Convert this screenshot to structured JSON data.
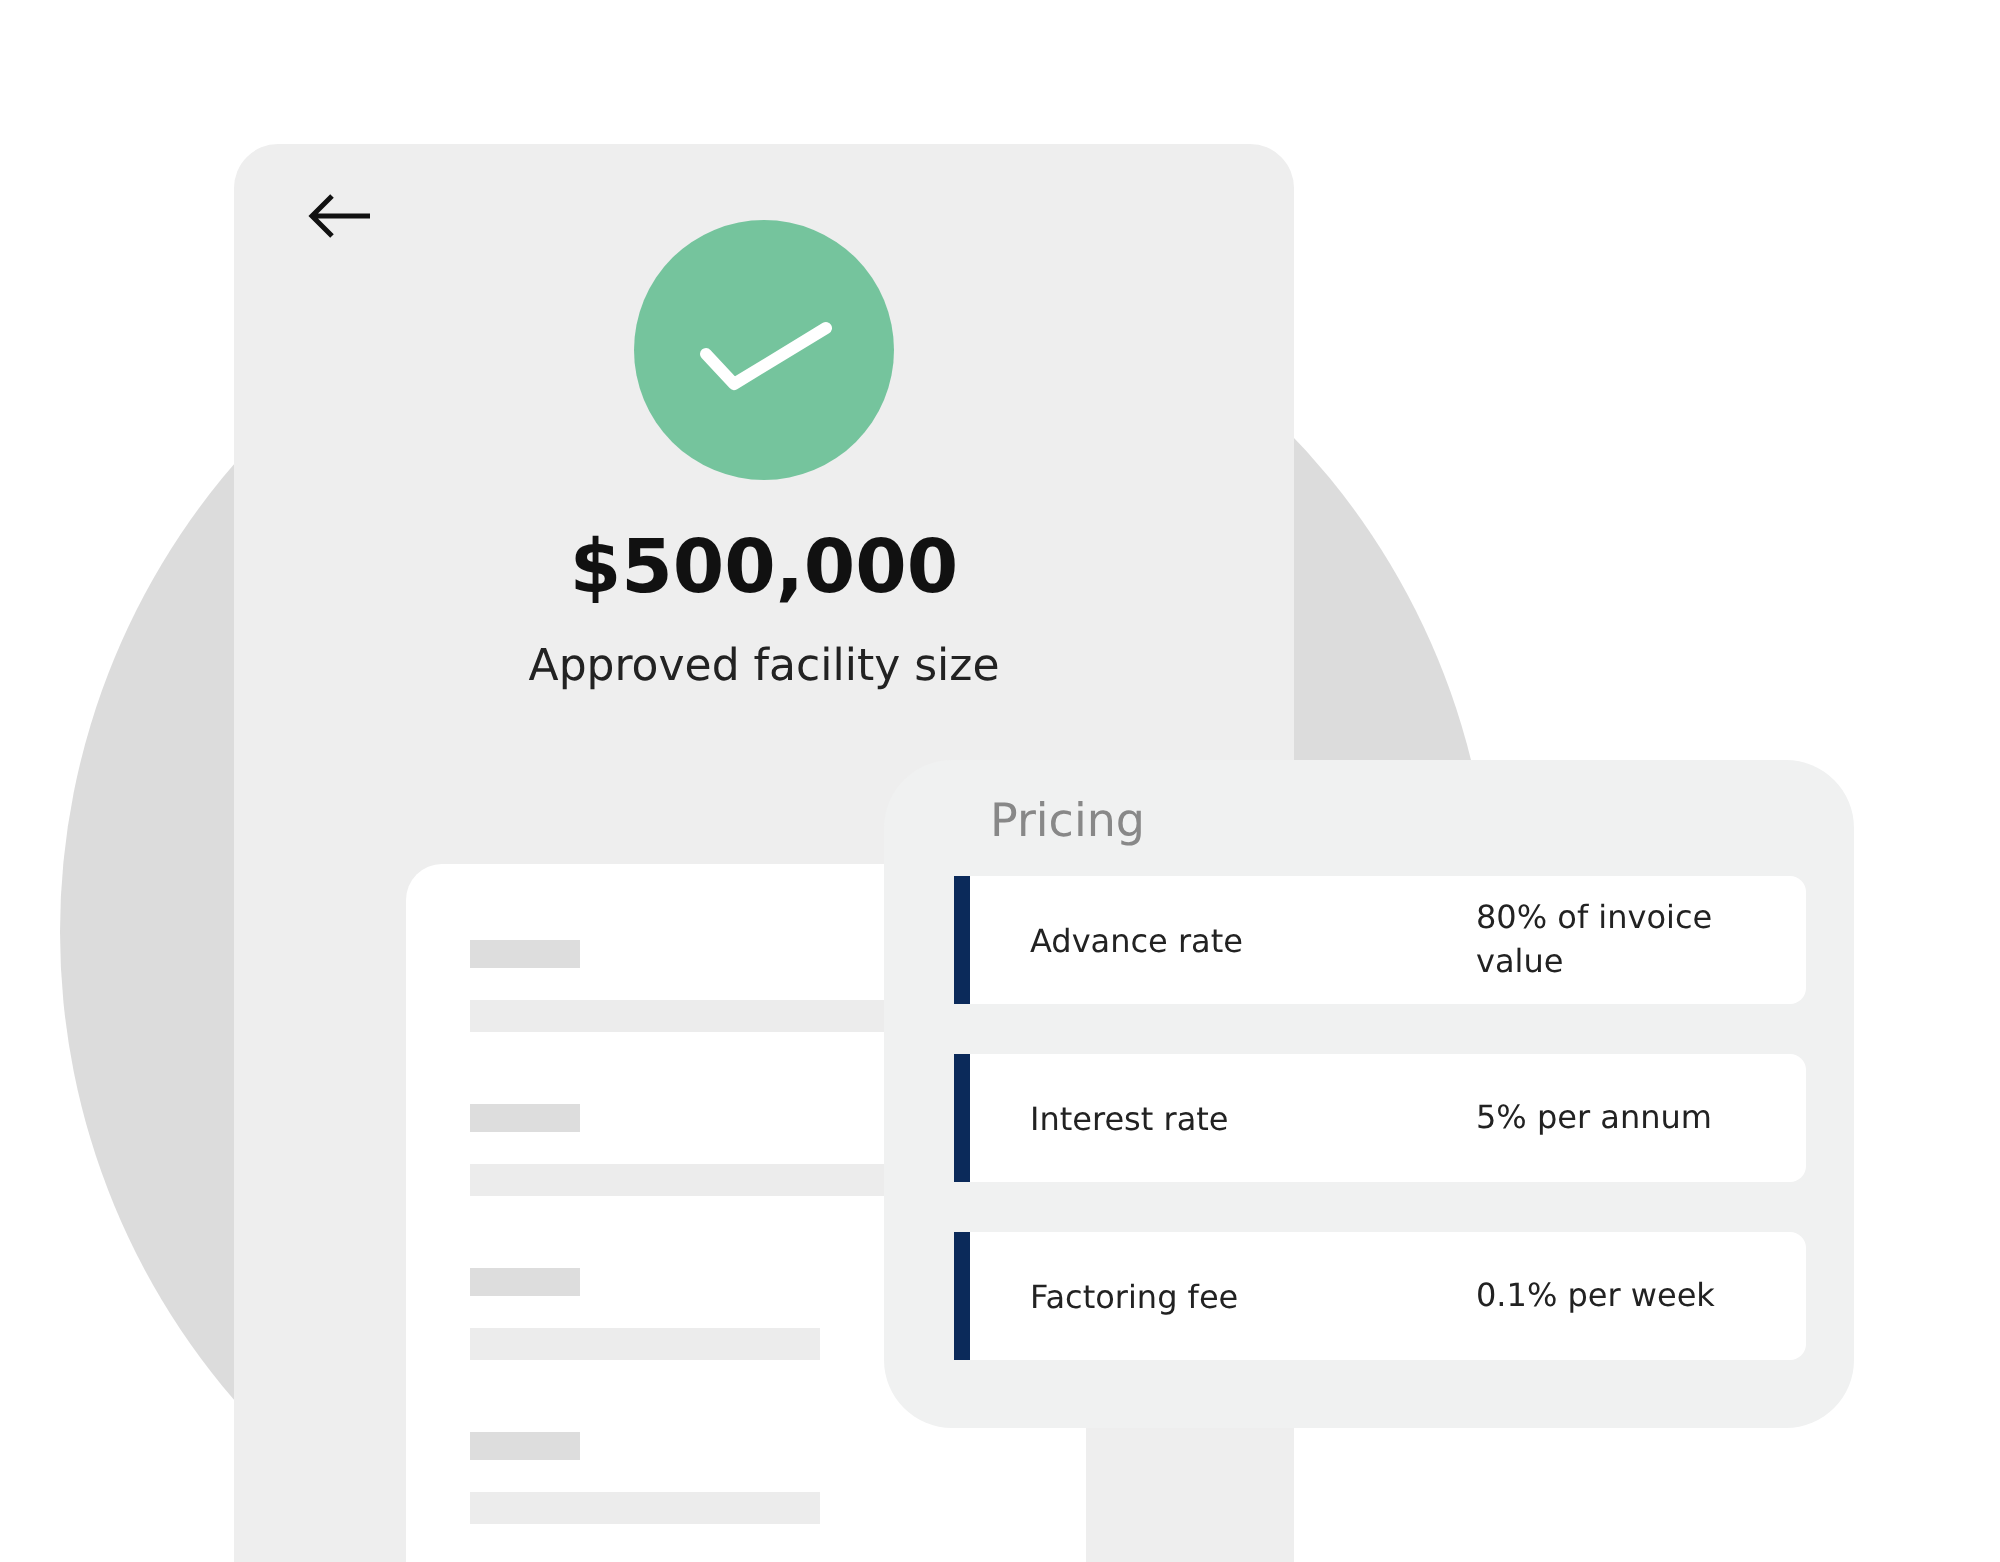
{
  "screen": {
    "amount": "$500,000",
    "caption": "Approved facility size"
  },
  "pricing": {
    "title": "Pricing",
    "rows": [
      {
        "label": "Advance rate",
        "value": "80% of invoice value"
      },
      {
        "label": "Interest rate",
        "value": "5% per annum"
      },
      {
        "label": "Factoring fee",
        "value": "0.1% per week"
      }
    ]
  }
}
